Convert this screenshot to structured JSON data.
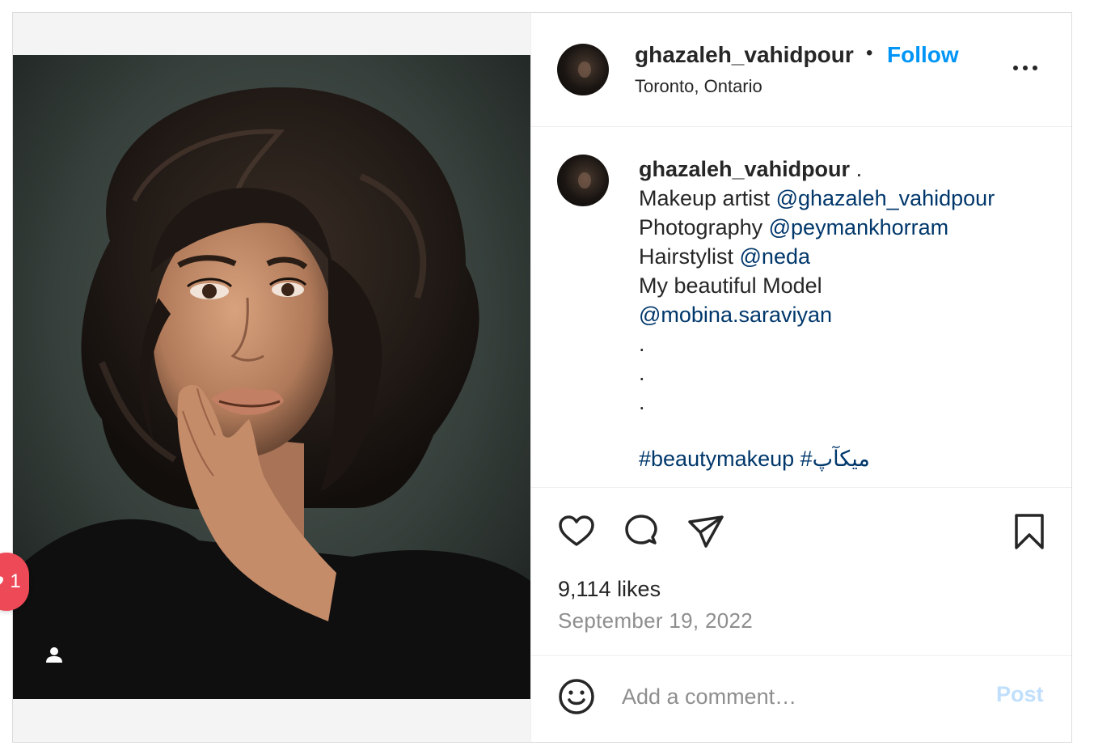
{
  "header": {
    "username": "ghazaleh_vahidpour",
    "separator": "•",
    "follow_label": "Follow",
    "location": "Toronto, Ontario",
    "more_icon": "more-horizontal-icon"
  },
  "caption": {
    "username": "ghazaleh_vahidpour",
    "username_suffix": " .",
    "lines": [
      {
        "text": "Makeup artist ",
        "mention": "@ghazaleh_vahidpour"
      },
      {
        "text": "Photography ",
        "mention": "@peymankhorram"
      },
      {
        "text": "Hairstylist ",
        "mention": "@neda"
      },
      {
        "text": "My beautiful Model",
        "mention": ""
      },
      {
        "text": "",
        "mention": "@mobina.saraviyan"
      }
    ],
    "dots": [
      ".",
      ".",
      "."
    ],
    "hashtag_line": "#beautymakeup #میکآپ"
  },
  "actions": {
    "like_icon": "heart-icon",
    "comment_icon": "comment-icon",
    "share_icon": "send-icon",
    "save_icon": "bookmark-icon"
  },
  "likes": "9,114 likes",
  "date": "September 19, 2022",
  "comment": {
    "placeholder": "Add a comment…",
    "post_label": "Post",
    "emoji_icon": "emoji-icon"
  },
  "media": {
    "user_tag_icon": "user-tag-icon",
    "notification_count": "1",
    "notification_icon": "heart-icon"
  },
  "colors": {
    "accent": "#0095f6",
    "link": "#00376b",
    "badge": "#ed4956",
    "muted": "#8e8e8e",
    "post_disabled": "#c0dffd"
  }
}
